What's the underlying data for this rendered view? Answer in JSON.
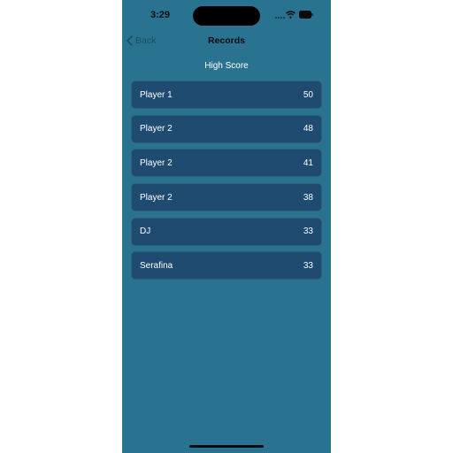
{
  "status_bar": {
    "time": "3:29",
    "icons": [
      "signal-icon",
      "wifi-icon",
      "battery-icon"
    ]
  },
  "nav": {
    "back_label": "Back",
    "title": "Records"
  },
  "section": {
    "title": "High Score"
  },
  "scores": [
    {
      "name": "Player 1",
      "score": "50"
    },
    {
      "name": "Player 2",
      "score": "48"
    },
    {
      "name": "Player 2",
      "score": "41"
    },
    {
      "name": "Player 2",
      "score": "38"
    },
    {
      "name": "DJ",
      "score": "33"
    },
    {
      "name": "Serafina",
      "score": "33"
    }
  ],
  "colors": {
    "background": "#2a7390",
    "row_background": "#1e4b6f",
    "back_tint": "#1b4d66",
    "text": "#ffffff"
  }
}
